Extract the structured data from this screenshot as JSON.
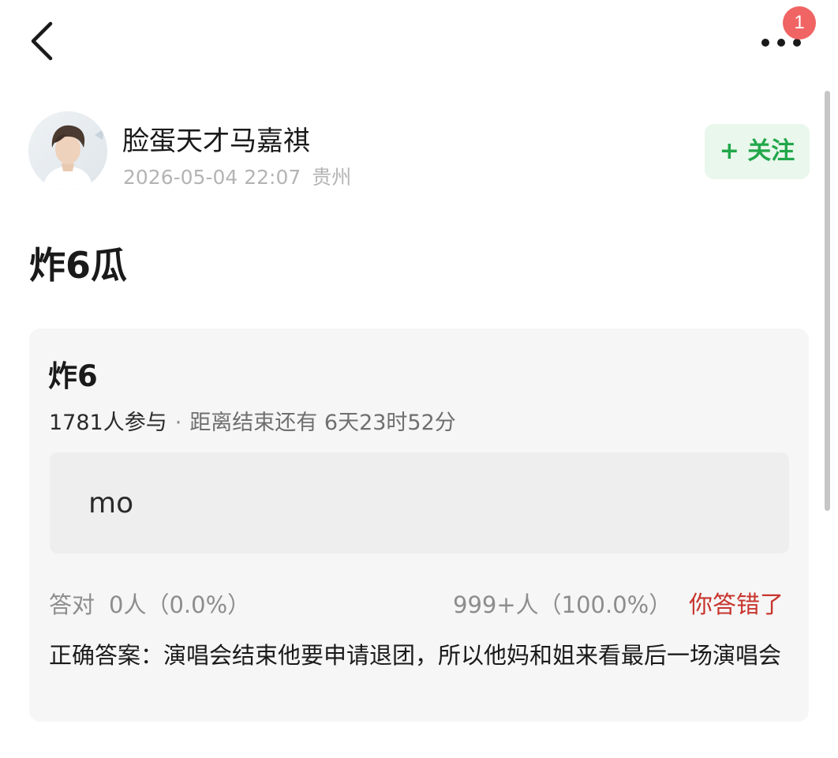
{
  "nav": {
    "back_icon": "chevron-left-icon",
    "more_icon": "more-horizontal-icon",
    "notification_count": "1"
  },
  "author": {
    "name": "脸蛋天才马嘉祺",
    "datetime": "2026-05-04 22:07",
    "location": "贵州",
    "follow_label": "+ 关注"
  },
  "post": {
    "title": "炸6瓜"
  },
  "quiz": {
    "title": "炸6",
    "participants": "1781人参与",
    "separator": "·",
    "countdown": "距离结束还有 6天23时52分",
    "my_answer": "mo",
    "correct_label": "答对",
    "correct_count": "0人（0.0%）",
    "wrong_count": "999+人（100.0%）",
    "result_label": "你答错了",
    "correct_answer": "正确答案：演唱会结束他要申请退团，所以他妈和姐来看最后一场演唱会"
  },
  "colors": {
    "accent_green": "#22a74a",
    "follow_bg": "#e9f7ec",
    "error_red": "#c8352e",
    "badge_red": "#f06464",
    "card_bg": "#f6f6f6"
  }
}
